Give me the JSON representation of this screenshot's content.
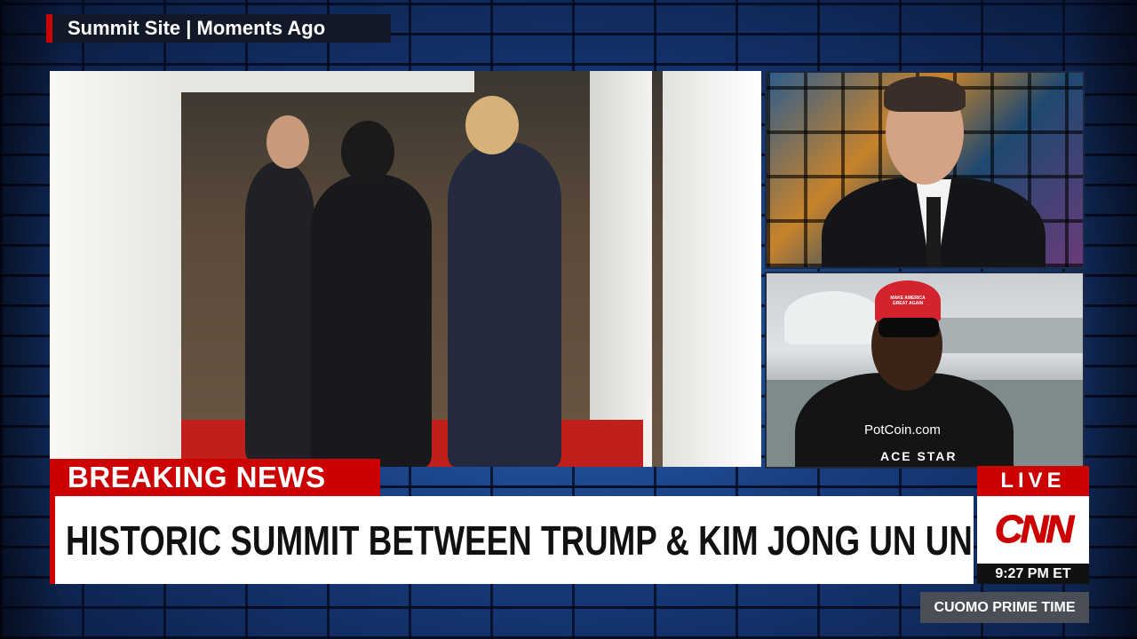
{
  "top_bar": {
    "location_label": "Summit Site | Moments Ago"
  },
  "main_video": {
    "subject": "Three men in suits at a doorway with red carpet"
  },
  "anchor_panel": {
    "subject": "Anchor in dark suit in front of city lights backdrop"
  },
  "guest_panel": {
    "subject": "Guest in red cap and sunglasses with city skyline behind",
    "cap_text": "MAKE AMERICA GREAT AGAIN",
    "shirt_text": "PotCoin.com",
    "shirt_subtext": "ACE STAR"
  },
  "lower_third": {
    "banner": "BREAKING NEWS",
    "headline": "HISTORIC SUMMIT BETWEEN TRUMP & KIM JONG UN UNDERWAY"
  },
  "bug": {
    "live_label": "LIVE",
    "network_logo": "CNN",
    "time": "9:27 PM ET",
    "show_name": "CUOMO PRIME TIME"
  },
  "colors": {
    "accent_red": "#cc0000",
    "headline_bg": "#ffffff",
    "background": "#0e2350"
  }
}
